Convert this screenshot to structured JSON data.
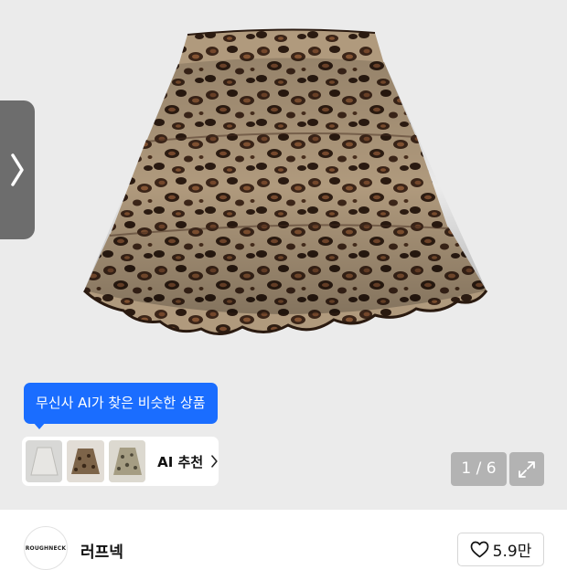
{
  "product": {
    "image_icon": "leopard-print-tiered-skirt",
    "image_index": "1 / 6"
  },
  "ai": {
    "tooltip": "무신사 AI가 찾은 비슷한 상품",
    "recommend_label": "AI 추천",
    "thumbnails": [
      "grey-skirt",
      "brown-print-skirt",
      "khaki-print-skirt"
    ]
  },
  "brand": {
    "logo_text": "ROUGHNECK",
    "name": "러프넥",
    "likes": "5.9만"
  },
  "colors": {
    "accent": "#1a6dff",
    "background": "#ebebeb"
  }
}
